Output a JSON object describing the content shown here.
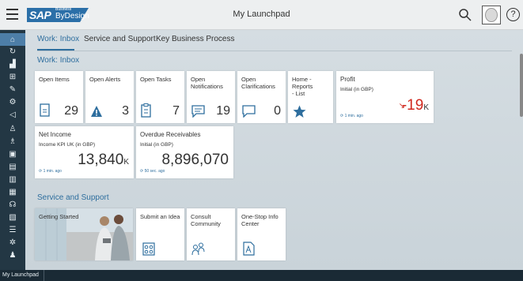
{
  "header": {
    "logo_sap": "SAP",
    "logo_business": "Business",
    "logo_bydesign": "ByDesign",
    "title": "My Launchpad",
    "help": "?"
  },
  "tabs": [
    {
      "label": "Work: Inbox"
    },
    {
      "label": "Service and Support"
    },
    {
      "label": "Key Business Process"
    }
  ],
  "sections": {
    "work_inbox": "Work: Inbox",
    "service_support": "Service and Support"
  },
  "inbox_tiles": [
    {
      "title": "Open Items",
      "count": "29",
      "icon": "document-icon"
    },
    {
      "title": "Open Alerts",
      "count": "3",
      "icon": "warning-icon"
    },
    {
      "title": "Open Tasks",
      "count": "7",
      "icon": "checklist-icon"
    },
    {
      "title": "Open\nNotifications",
      "count": "19",
      "icon": "message-icon"
    },
    {
      "title": "Open\nClarifications",
      "count": "0",
      "icon": "comment-icon"
    },
    {
      "title": "Home - Reports\n- List",
      "icon": "star-icon"
    }
  ],
  "kpi_tiles": {
    "profit": {
      "title": "Profit",
      "subtitle": "Initial (in GBP)",
      "value": "-19",
      "unit": "K",
      "time": "1 min. ago",
      "trend": "down"
    },
    "net_income": {
      "title": "Net Income",
      "subtitle": "Income KPI UK (in GBP)",
      "value": "13,840",
      "unit": "K",
      "time": "1 min. ago"
    },
    "overdue": {
      "title": "Overdue Receivables",
      "subtitle": "Initial (in GBP)",
      "value": "8,896,070",
      "time": "50 sec. ago"
    }
  },
  "service_tiles": [
    {
      "title": "Getting Started"
    },
    {
      "title": "Submit an Idea",
      "icon": "idea-icon"
    },
    {
      "title": "Consult\nCommunity",
      "icon": "community-icon"
    },
    {
      "title": "One-Stop Info\nCenter",
      "icon": "info-center-icon"
    }
  ],
  "status_bar": {
    "label": "My Launchpad"
  },
  "colors": {
    "accent": "#2e6e9e",
    "sidebar": "#233744",
    "negative": "#d0271d"
  }
}
